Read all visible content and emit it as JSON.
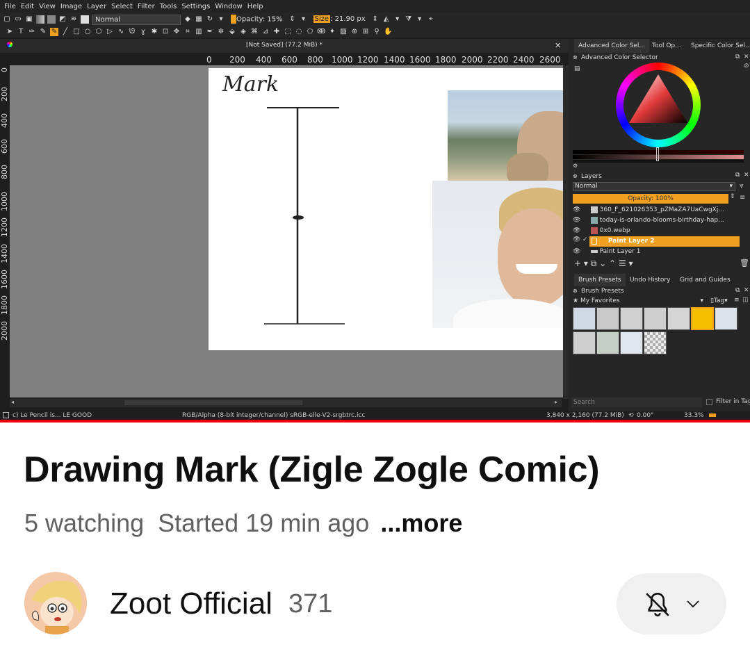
{
  "krita": {
    "menu": [
      "File",
      "Edit",
      "View",
      "Image",
      "Layer",
      "Select",
      "Filter",
      "Tools",
      "Settings",
      "Window",
      "Help"
    ],
    "blend_mode": "Normal",
    "opacity": "Opacity: 15%",
    "size_prefix": "Size",
    "size_value": ": 21.90 px",
    "doc_title": "[Not Saved]  (77.2 MiB) *",
    "ruler_h": [
      "0",
      "200",
      "400",
      "600",
      "800",
      "1000",
      "1200",
      "1400",
      "1600",
      "1800",
      "2000",
      "2200",
      "2400",
      "2600"
    ],
    "ruler_v": [
      "0",
      "200",
      "400",
      "600",
      "800",
      "1000",
      "1200",
      "1400",
      "1600",
      "1800",
      "2000"
    ],
    "canvas_text": "Mark",
    "status": {
      "left": "c) Le Pencil is... LE GOOD",
      "mid": "RGB/Alpha (8-bit integer/channel)  sRGB-elle-V2-srgbtrc.icc",
      "dims": "3,840 x 2,160 (77.2 MiB)",
      "angle": "0.00°",
      "zoom": "33.3%"
    },
    "panel_tabs": [
      "Advanced Color Sel...",
      "Tool Op...",
      "Specific Color Sel..."
    ],
    "color_selector_title": "Advanced Color Selector",
    "layers_title": "Layers",
    "layers_blend": "Normal",
    "layers_opacity": "Opacity:  100%",
    "layers": [
      "360_F_621026353_pZMaZA7UaCwgXj...",
      "today-is-orlando-blooms-birthday-hap...",
      "0x0.webp",
      "Paint Layer 2",
      "Paint Layer 1"
    ],
    "dock_tabs": [
      "Brush Presets",
      "Undo History",
      "Grid and Guides"
    ],
    "brush_presets_title": "Brush Presets",
    "favorites": "My Favorites",
    "tag": "Tag",
    "search_placeholder": "Search",
    "filter_in_tag": "Filter in Tag",
    "colors": {
      "accent": "#f0a020",
      "dark": "#1e1e1e"
    }
  },
  "youtube": {
    "title": "Drawing Mark (Zigle Zogle Comic)",
    "watching": "5 watching",
    "started": "Started 19 min ago",
    "more": "...more",
    "channel": "Zoot Official",
    "subscribers": "371",
    "bell_icon": "bell-off-icon",
    "chevron_icon": "chevron-down-icon"
  }
}
